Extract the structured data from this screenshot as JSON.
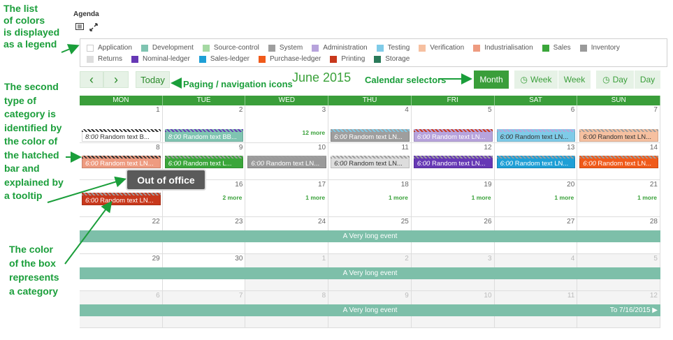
{
  "annotations": {
    "legend_note": [
      "The list",
      "of colors",
      "is displayed",
      "as a legend"
    ],
    "category_note": [
      "The second",
      "type of",
      "category is",
      "identified by",
      "the color  of",
      "the hatched",
      "bar and",
      "explained by",
      "a tooltip"
    ],
    "box_note": [
      "The color",
      "of the box",
      "represents",
      "a category"
    ],
    "paging_note": "Paging / navigation icons",
    "selectors_note": "Calendar selectors"
  },
  "agenda": {
    "title": "Agenda"
  },
  "legend": {
    "row1": [
      {
        "label": "Application",
        "color": "#ffffff"
      },
      {
        "label": "Development",
        "color": "#7fc4b1"
      },
      {
        "label": "Source-control",
        "color": "#a5d9a3"
      },
      {
        "label": "System",
        "color": "#9e9e9e"
      },
      {
        "label": "Administration",
        "color": "#b7a3dc"
      },
      {
        "label": "Testing",
        "color": "#7fcbe8"
      },
      {
        "label": "Verification",
        "color": "#f6c0a0"
      },
      {
        "label": "Industrialisation",
        "color": "#ee9b80"
      },
      {
        "label": "Sales",
        "color": "#3aa63a"
      },
      {
        "label": "Inventory",
        "color": "#9a9a9a"
      }
    ],
    "row2": [
      {
        "label": "Returns",
        "color": "#dddddd"
      },
      {
        "label": "Nominal-ledger",
        "color": "#6638b5"
      },
      {
        "label": "Sales-ledger",
        "color": "#1e9fd6"
      },
      {
        "label": "Purchase-ledger",
        "color": "#f05a1a"
      },
      {
        "label": "Printing",
        "color": "#c8381c"
      },
      {
        "label": "Storage",
        "color": "#2a7a5a"
      }
    ]
  },
  "nav": {
    "prev": "‹",
    "next": "›",
    "today": "Today",
    "title": "June 2015"
  },
  "selectors": {
    "month": "Month",
    "week_icon": "Week",
    "week": "Week",
    "day_icon": "Day",
    "day": "Day"
  },
  "weekdays": [
    "MON",
    "TUE",
    "WED",
    "THU",
    "FRI",
    "SAT",
    "SUN"
  ],
  "weeks": [
    {
      "days": [
        "1",
        "2",
        "3",
        "4",
        "5",
        "6",
        "7"
      ],
      "other": [
        false,
        false,
        false,
        false,
        false,
        false,
        false
      ],
      "more": {
        "2": "12 more"
      },
      "events": [
        {
          "day": 0,
          "time": "8:00",
          "text": "Random text B...",
          "bg": "#ffffff",
          "fg": "#333",
          "hatch": "#333"
        },
        {
          "day": 1,
          "time": "8:00",
          "text": "Random text BB...",
          "bg": "#7fc4b1",
          "fg": "#fff",
          "hatch": "#6638b5"
        },
        {
          "day": 3,
          "time": "6:00",
          "text": "Random text LN...",
          "bg": "#9e9e9e",
          "fg": "#fff",
          "hatch": "#7fcbe8"
        },
        {
          "day": 4,
          "time": "6:00",
          "text": "Random text LN...",
          "bg": "#b7a3dc",
          "fg": "#fff",
          "hatch": "#c8381c"
        },
        {
          "day": 5,
          "time": "6:00",
          "text": "Random text LN...",
          "bg": "#7fcbe8",
          "fg": "#333",
          "hatch": "#b7a3dc"
        },
        {
          "day": 6,
          "time": "6:00",
          "text": "Random text LN...",
          "bg": "#f6c0a0",
          "fg": "#333",
          "hatch": "#9e9e9e"
        }
      ]
    },
    {
      "days": [
        "8",
        "9",
        "10",
        "11",
        "12",
        "13",
        "14"
      ],
      "other": [
        false,
        false,
        false,
        false,
        false,
        false,
        false
      ],
      "more": {},
      "events": [
        {
          "day": 0,
          "time": "6:00",
          "text": "Random text LN...",
          "bg": "#ee9b80",
          "fg": "#fff",
          "hatch": "#333"
        },
        {
          "day": 1,
          "time": "6:00",
          "text": "Random text L...",
          "bg": "#3aa63a",
          "fg": "#fff",
          "hatch": "#9e9e9e"
        },
        {
          "day": 2,
          "time": "6:00",
          "text": "Random text LN...",
          "bg": "#9a9a9a",
          "fg": "#fff",
          "hatch": "#9e9e9e"
        },
        {
          "day": 3,
          "time": "6:00",
          "text": "Random text LN...",
          "bg": "#dddddd",
          "fg": "#333",
          "hatch": "#9e9e9e"
        },
        {
          "day": 4,
          "time": "6:00",
          "text": "Random text LN...",
          "bg": "#6638b5",
          "fg": "#fff",
          "hatch": "#9e9e9e"
        },
        {
          "day": 5,
          "time": "6:00",
          "text": "Random text LN...",
          "bg": "#1e9fd6",
          "fg": "#fff",
          "hatch": "#9e9e9e"
        },
        {
          "day": 6,
          "time": "6:00",
          "text": "Random text LN...",
          "bg": "#f05a1a",
          "fg": "#fff",
          "hatch": "#9e9e9e"
        }
      ]
    },
    {
      "days": [
        "15",
        "16",
        "17",
        "18",
        "19",
        "20",
        "21"
      ],
      "other": [
        false,
        false,
        false,
        false,
        false,
        false,
        false
      ],
      "more": {
        "1": "2 more",
        "2": "1 more",
        "3": "1 more",
        "4": "1 more",
        "5": "1 more",
        "6": "1 more"
      },
      "events": [
        {
          "day": 0,
          "time": "6:00",
          "text": "Random text LN...",
          "bg": "#c8381c",
          "fg": "#fff",
          "hatch": "#9e9e9e"
        }
      ]
    },
    {
      "days": [
        "22",
        "23",
        "24",
        "25",
        "26",
        "27",
        "28"
      ],
      "other": [
        false,
        false,
        false,
        false,
        false,
        false,
        false
      ],
      "more": {},
      "events": [],
      "long": "A Very long event"
    },
    {
      "days": [
        "29",
        "30",
        "1",
        "2",
        "3",
        "4",
        "5"
      ],
      "other": [
        false,
        false,
        true,
        true,
        true,
        true,
        true
      ],
      "more": {},
      "events": [],
      "long": "A Very long event"
    },
    {
      "days": [
        "6",
        "7",
        "8",
        "9",
        "10",
        "11",
        "12"
      ],
      "other": [
        true,
        true,
        true,
        true,
        true,
        true,
        true
      ],
      "more": {},
      "events": [],
      "long": "A Very long event",
      "long_right": "To 7/16/2015"
    }
  ],
  "tooltip": "Out of office"
}
